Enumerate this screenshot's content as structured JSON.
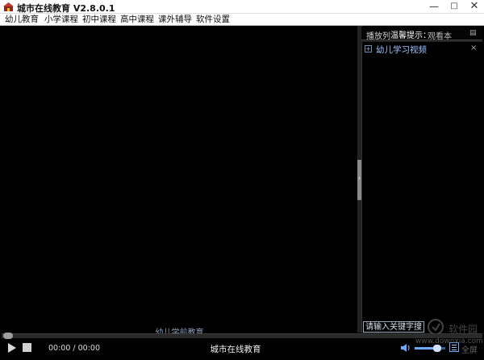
{
  "window": {
    "title": "城市在线教育 V2.8.0.1",
    "minimize": "—",
    "maximize": "□",
    "close": "✕"
  },
  "menu": {
    "items": [
      "幼儿教育",
      "小学课程",
      "初中课程",
      "高中课程",
      "课外辅导",
      "软件设置"
    ]
  },
  "video": {
    "caption": "幼儿学前教育"
  },
  "playlist": {
    "header_label": "播放列",
    "tip": "温馨提示：",
    "tip_text": "观看本",
    "items": [
      {
        "label": "幼儿学习视频",
        "expand": "+",
        "remove": "×"
      }
    ],
    "search_placeholder": "请输入关键字搜索"
  },
  "player": {
    "time": "00:00 / 00:00",
    "brand": "城市在线教育",
    "fullscreen": "全屏",
    "volume_level": 0.7,
    "progress": 0
  },
  "watermark": {
    "text": "软件园",
    "domain": "www.downxia.com"
  },
  "colors": {
    "accent": "#6ea8ff",
    "link": "#9ec0ff",
    "background": "#000000"
  }
}
